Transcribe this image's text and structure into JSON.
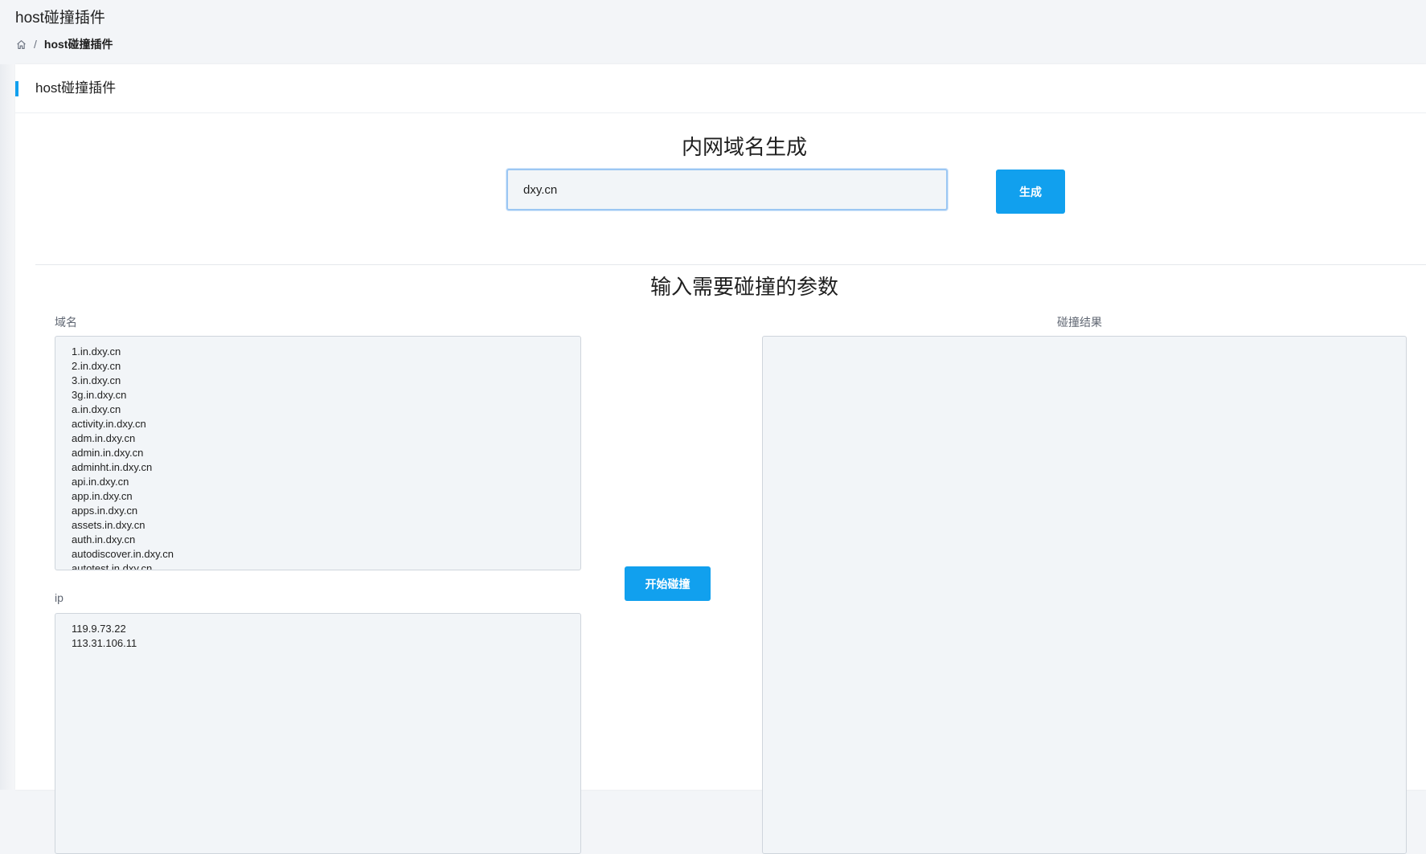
{
  "page": {
    "title": "host碰撞插件"
  },
  "breadcrumb": {
    "home_icon": "home-icon",
    "separator": "/",
    "current": "host碰撞插件"
  },
  "card": {
    "title": "host碰撞插件"
  },
  "generate": {
    "title": "内网域名生成",
    "input_value": "dxy.cn",
    "button_label": "生成"
  },
  "params": {
    "title": "输入需要碰撞的参数",
    "domains_label": "域名",
    "domains_value": "1.in.dxy.cn\n2.in.dxy.cn\n3.in.dxy.cn\n3g.in.dxy.cn\na.in.dxy.cn\nactivity.in.dxy.cn\nadm.in.dxy.cn\nadmin.in.dxy.cn\nadminht.in.dxy.cn\napi.in.dxy.cn\napp.in.dxy.cn\napps.in.dxy.cn\nassets.in.dxy.cn\nauth.in.dxy.cn\nautodiscover.in.dxy.cn\nautotest.in.dxy.cn",
    "ip_label": "ip",
    "ip_value": "119.9.73.22\n113.31.106.11",
    "result_label": "碰撞结果",
    "result_value": "",
    "start_button_label": "开始碰撞"
  },
  "colors": {
    "accent": "#11a0ee",
    "background": "#f3f5f8"
  }
}
